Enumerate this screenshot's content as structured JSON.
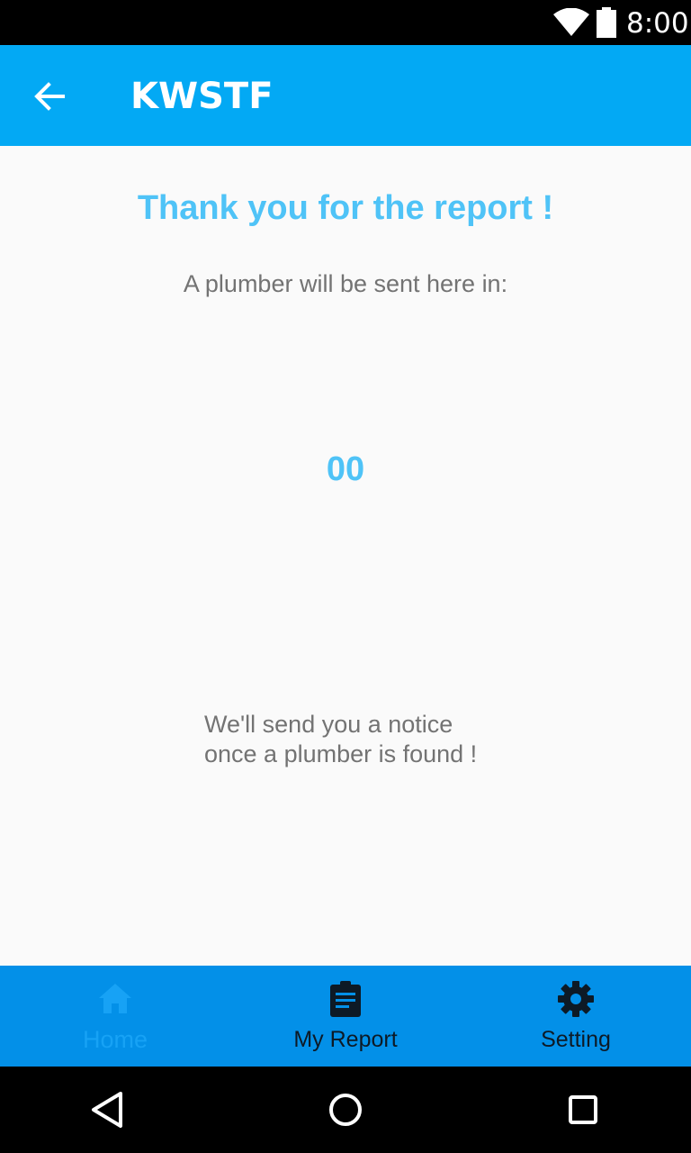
{
  "status_bar": {
    "time": "8:00",
    "icons": [
      "wifi-icon",
      "battery-icon"
    ]
  },
  "app_bar": {
    "title": "KWSTF",
    "back_icon": "arrow-back-icon"
  },
  "content": {
    "heading": "Thank you for the report !",
    "subtitle": "A plumber will be sent here in:",
    "countdown": "00",
    "notice_line1": "We'll send you a notice",
    "notice_line2": "once a plumber is found !"
  },
  "bottom_nav": {
    "items": [
      {
        "label": "Home",
        "icon": "home-icon",
        "active": true
      },
      {
        "label": "My Report",
        "icon": "clipboard-icon",
        "active": false
      },
      {
        "label": "Setting",
        "icon": "gear-icon",
        "active": false
      }
    ]
  },
  "system_nav": {
    "icons": [
      "back-triangle-icon",
      "home-circle-icon",
      "recents-square-icon"
    ]
  },
  "colors": {
    "app_bar": "#03a9f4",
    "bottom_nav": "#0390e8",
    "accent_text": "#4fc3f7",
    "body_text": "#737373",
    "active_nav": "#17a2f5"
  }
}
